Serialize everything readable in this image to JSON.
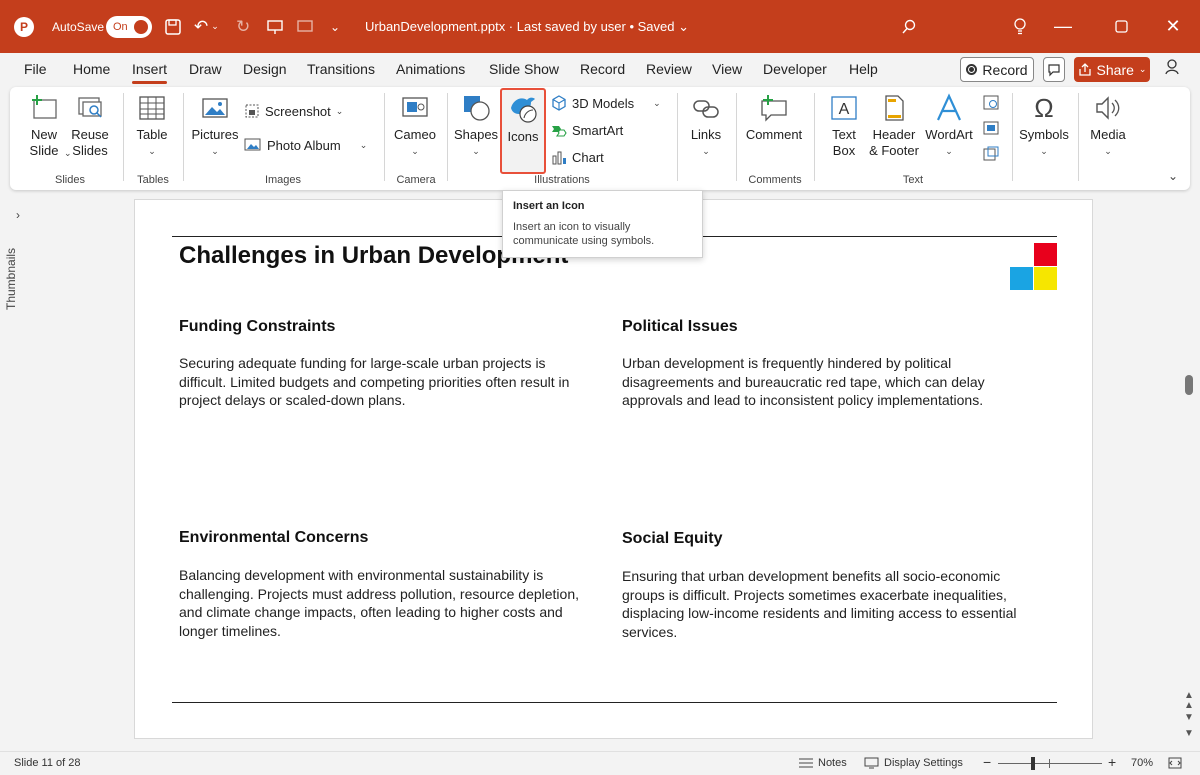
{
  "titlebar": {
    "autosave_label": "AutoSave",
    "toggle_label": "On",
    "doc_title": "UrbanDevelopment.pptx  ·  Last saved by user  •  Saved  ⌄",
    "colors": {
      "accent": "#c43e1c"
    }
  },
  "menu": {
    "tabs": [
      "File",
      "Home",
      "Insert",
      "Draw",
      "Design",
      "Transitions",
      "Animations",
      "Slide Show",
      "Record",
      "Review",
      "View",
      "Developer",
      "Help"
    ],
    "active_tab": "Insert",
    "record_label": "Record",
    "share_label": "Share"
  },
  "ribbon": {
    "groups": {
      "slides": "Slides",
      "tables": "Tables",
      "images": "Images",
      "camera": "Camera",
      "illustrations": "Illustrations",
      "comments": "Comments",
      "text": "Text"
    },
    "buttons": {
      "new_slide": "New Slide",
      "reuse_slides": "Reuse Slides",
      "table": "Table",
      "pictures": "Pictures",
      "screenshot": "Screenshot",
      "photo_album": "Photo Album",
      "cameo": "Cameo",
      "shapes": "Shapes",
      "icons": "Icons",
      "models_3d": "3D Models",
      "smartart": "SmartArt",
      "chart": "Chart",
      "links": "Links",
      "comment": "Comment",
      "text_box": "Text Box",
      "header_footer": "Header & Footer",
      "wordart": "WordArt",
      "symbols": "Symbols",
      "media": "Media"
    }
  },
  "tooltip": {
    "title": "Insert an Icon",
    "body": "Insert an icon to visually communicate using symbols."
  },
  "thumbnails_label": "Thumbnails",
  "slide": {
    "title": "Challenges in Urban Development",
    "sections": [
      {
        "heading": "Funding Constraints",
        "body": "Securing adequate funding for large-scale urban projects is difficult. Limited budgets and competing priorities often result in project delays or scaled-down plans."
      },
      {
        "heading": "Political Issues",
        "body": "Urban development is frequently hindered by political disagreements and bureaucratic red tape, which can delay approvals and lead to inconsistent policy implementations."
      },
      {
        "heading": "Environmental Concerns",
        "body": "Balancing development with environmental sustainability is challenging. Projects must address pollution, resource depletion, and climate change impacts, often leading to higher costs and longer timelines."
      },
      {
        "heading": "Social Equity",
        "body": "Ensuring that urban development benefits all socio-economic groups is difficult. Projects sometimes exacerbate inequalities, displacing low-income residents and limiting access to essential services."
      }
    ],
    "deco_colors": [
      "#e8001c",
      "#1aa4e3",
      "#f6e600"
    ]
  },
  "status": {
    "slide_info": "Slide 11 of 28",
    "notes": "Notes",
    "display_settings": "Display Settings",
    "zoom": "70%",
    "minus": "−",
    "plus": "+"
  }
}
